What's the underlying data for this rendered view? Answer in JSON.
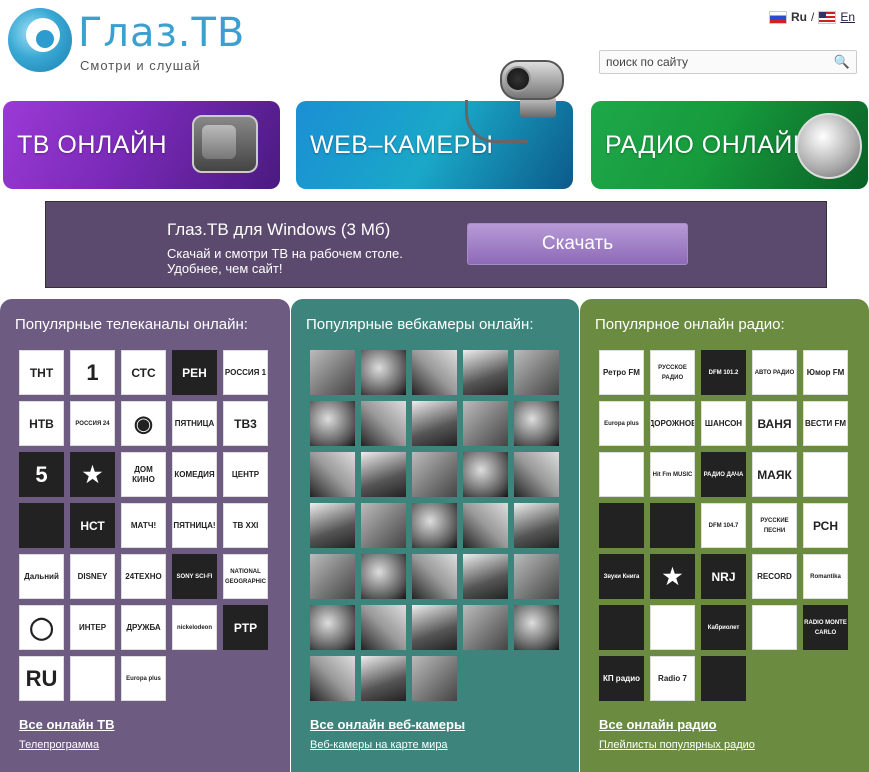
{
  "header": {
    "logo_name": "Глаз.ТВ",
    "logo_tagline": "Смотри и слушай",
    "lang_ru": "Ru",
    "lang_sep": "/",
    "lang_en": "En",
    "search_placeholder": "поиск по сайту"
  },
  "banners": {
    "tv": "ТВ ОНЛАЙН",
    "web": "WEB–КАМЕРЫ",
    "radio": "РАДИО ОНЛАЙН"
  },
  "download": {
    "title": "Глаз.ТВ для Windows (3 Мб)",
    "line1": "Скачай и смотри ТВ на рабочем столе.",
    "line2": "Удобнее, чем сайт!",
    "button": "Скачать"
  },
  "tv": {
    "title": "Популярные телеканалы онлайн:",
    "channels": [
      "ТНТ",
      "1",
      "СТС",
      "РЕН",
      "РОССИЯ 1",
      "НТВ",
      "РОССИЯ 24",
      "◉",
      "ПЯТНИЦА",
      "ТВ3",
      "5",
      "★",
      "ДОМ КИНО",
      "КОМЕДИЯ",
      "ЦЕНТР",
      "",
      "НСТ",
      "МАТЧ!",
      "ПЯТНИЦА!",
      "ТВ XXI",
      "Дальний",
      "DISNEY",
      "24ТЕХНО",
      "SONY SCI-FI",
      "NATIONAL GEOGRAPHIC",
      "◯",
      "ИНТЕР",
      "ДРУЖБА",
      "nickelodeon",
      "РТР",
      "RU",
      "",
      "Europa plus"
    ],
    "link_all": "Все онлайн ТВ",
    "link_sub": "Телепрограмма"
  },
  "web": {
    "title": "Популярные вебкамеры онлайн:",
    "count": 33,
    "link_all": "Все онлайн веб-камеры",
    "link_sub": "Веб-камеры на карте мира"
  },
  "radio": {
    "title": "Популярное онлайн радио:",
    "stations": [
      "Ретро FM",
      "РУССКОЕ РАДИО",
      "DFM 101.2",
      "АВТО РАДИО",
      "Юмор FM",
      "Europa plus",
      "ДОРОЖНОЕ",
      "ШАНСОН",
      "ВАНЯ",
      "ВЕСТИ FM",
      "",
      "Hit Fm MUSIC",
      "РАДИО ДАЧА",
      "МАЯК",
      "",
      "",
      "",
      "DFM 104.7",
      "РУССКИЕ ПЕСНИ",
      "РСН",
      "Звуки Книга",
      "★",
      "NRJ",
      "RECORD",
      "Romantika",
      "",
      "",
      "Кабриолет",
      "",
      "RADIO MONTE CARLO",
      "КП радио",
      "Radio 7",
      ""
    ],
    "link_all": "Все онлайн радио",
    "link_sub": "Плейлисты популярных радио"
  },
  "colors": {
    "tv_column": "#6d5b82",
    "web_column": "#3d857c",
    "radio_column": "#6a8b40",
    "download_bg": "#5b4a6e",
    "brand": "#3aa0cf"
  }
}
